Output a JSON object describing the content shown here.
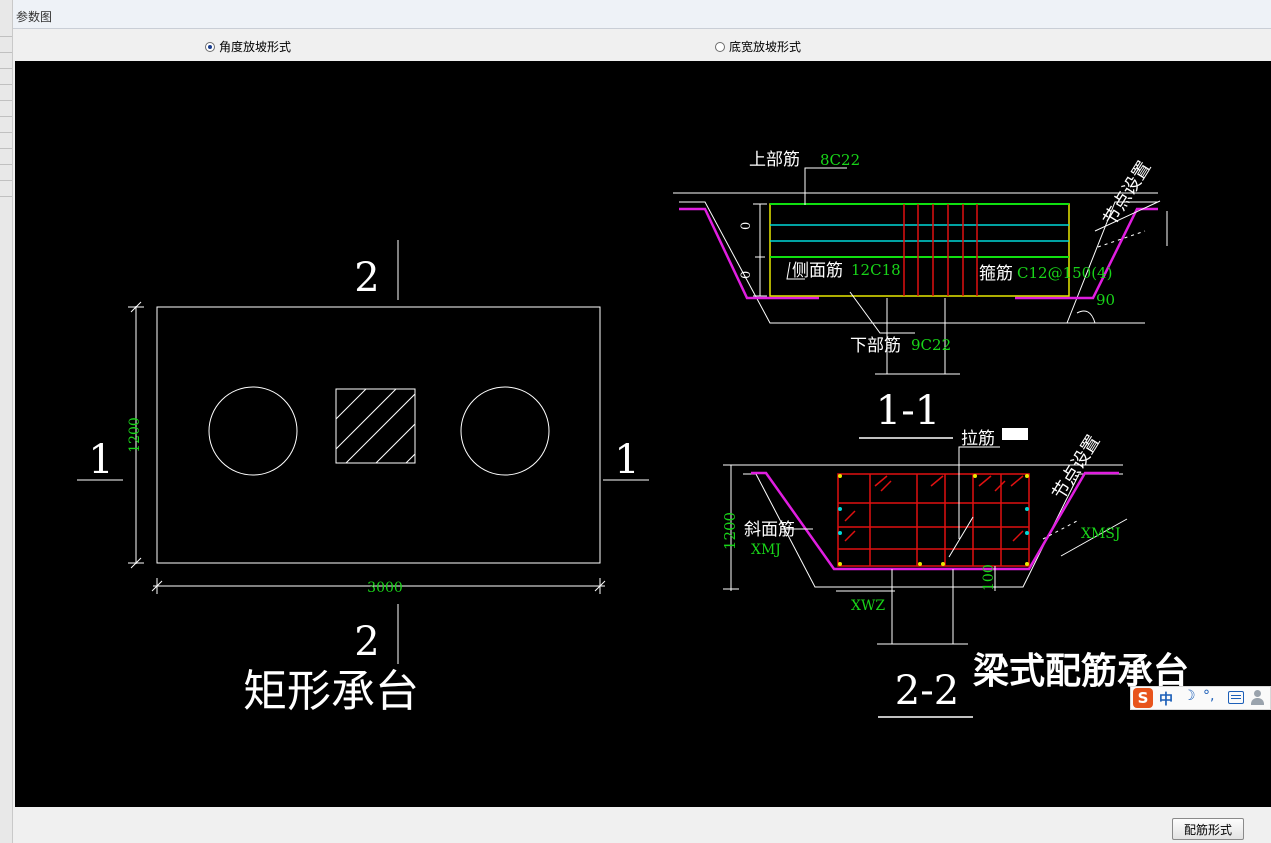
{
  "window": {
    "title": "参数图"
  },
  "options": {
    "angle_slope": {
      "label": "角度放坡形式",
      "selected": true
    },
    "width_slope": {
      "label": "底宽放坡形式",
      "selected": false
    }
  },
  "drawing": {
    "plan": {
      "section_mark_top": "2",
      "section_mark_bottom": "2",
      "section_mark_left": "1",
      "section_mark_right": "1",
      "height_dim": "1200",
      "width_dim": "3000",
      "caption": "矩形承台"
    },
    "section_1_1": {
      "top_rebar_label": "上部筋",
      "top_rebar_value": "8C22",
      "node_setting": "节点设置",
      "dim_zero_a": "0",
      "dim_zero_b": "0",
      "side_rebar_label": "侧面筋",
      "side_rebar_value": "12C18",
      "stirrup_label": "箍筋",
      "stirrup_value": "C12@150(4)",
      "angle_value": "90",
      "bottom_rebar_label": "下部筋",
      "bottom_rebar_value": "9C22",
      "title": "1-1"
    },
    "section_2_2": {
      "tie_label": "拉筋",
      "node_setting": "节点设置",
      "height_dim": "1200",
      "slope_rebar_label": "斜面筋",
      "slope_rebar_code": "XMJ",
      "slope_side_code": "XMSJ",
      "bottom_code": "XWZ",
      "cover_dim": "100",
      "title": "2-2",
      "caption": "梁式配筋承台"
    }
  },
  "ime": {
    "logo": "S",
    "lang": "中"
  },
  "buttons": {
    "rebar_form": "配筋形式"
  },
  "colors": {
    "canvas_bg": "#000000",
    "line_white": "#ffffff",
    "dim_green": "#19d419",
    "rebar_red": "#e01010",
    "rebar_yellow": "#e8e800",
    "rebar_cyan": "#00d8d8",
    "rebar_magenta": "#e01ee0",
    "rebar_green": "#10e010"
  }
}
